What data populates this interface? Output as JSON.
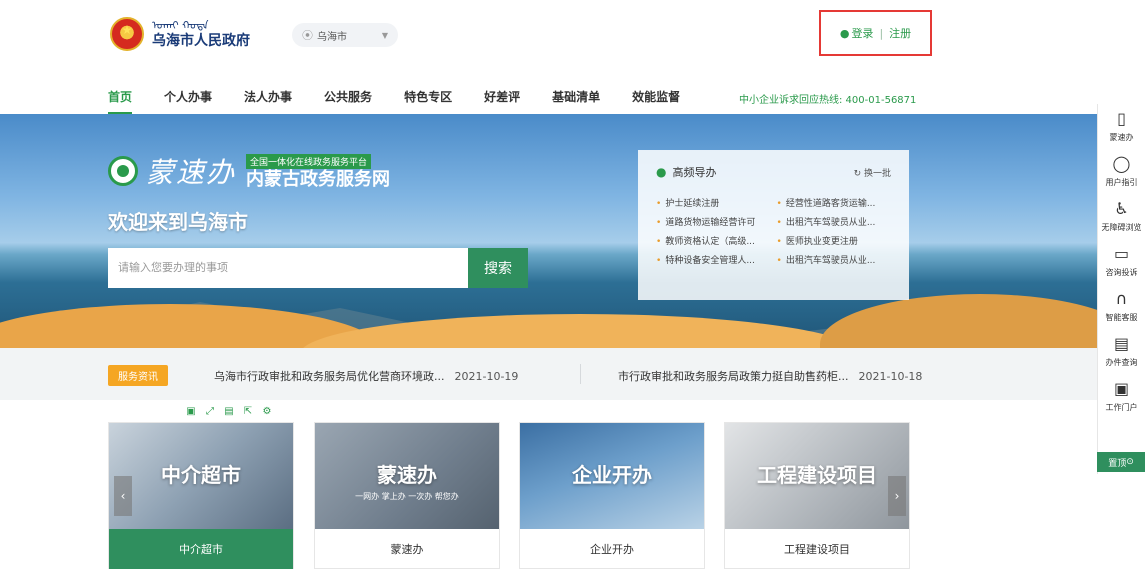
{
  "header": {
    "mongol_script": "ᠤᠬᠠᠢ ᠬᠣᠲᠠ",
    "city_name": "乌海市人民政府",
    "region_select": "乌海市",
    "login_label": "登录",
    "register_label": "注册",
    "separator": "|"
  },
  "nav": {
    "items": [
      "首页",
      "个人办事",
      "法人办事",
      "公共服务",
      "特色专区",
      "好差评",
      "基础清单",
      "效能监督"
    ],
    "hotline": "中小企业诉求回应热线: 400-01-56871"
  },
  "banner": {
    "brand_script": "蒙速办",
    "brand_tag": "全国一体化在线政务服务平台",
    "brand_title": "内蒙古政务服务网",
    "welcome": "欢迎来到乌海市",
    "search_placeholder": "请输入您要办理的事项",
    "search_button": "搜索"
  },
  "hot_panel": {
    "title": "高频导办",
    "refresh": "换一批",
    "items": [
      "护士延续注册",
      "经营性道路客货运输...",
      "道路货物运输经营许可",
      "出租汽车驾驶员从业...",
      "教师资格认定（高级...",
      "医师执业变更注册",
      "特种设备安全管理人...",
      "出租汽车驾驶员从业..."
    ]
  },
  "news": {
    "badge": "服务资讯",
    "items": [
      {
        "title": "乌海市行政审批和政务服务局优化营商环境政...",
        "date": "2021-10-19"
      },
      {
        "title": "市行政审批和政务服务局政策力挺自助售药柜...",
        "date": "2021-10-18"
      }
    ]
  },
  "cards": [
    {
      "image_text": "中介超市",
      "image_sub": "",
      "label": "中介超市"
    },
    {
      "image_text": "蒙速办",
      "image_sub": "一网办 掌上办 一次办 帮您办",
      "label": "蒙速办"
    },
    {
      "image_text": "企业开办",
      "image_sub": "",
      "label": "企业开办"
    },
    {
      "image_text": "工程建设项目",
      "image_sub": "",
      "label": "工程建设项目"
    }
  ],
  "sidebar": {
    "items": [
      {
        "label": "蒙速办",
        "icon": "mobile-icon"
      },
      {
        "label": "用户指引",
        "icon": "lightbulb-icon"
      },
      {
        "label": "无障碍浏览",
        "icon": "accessibility-icon"
      },
      {
        "label": "咨询投诉",
        "icon": "chat-icon"
      },
      {
        "label": "智能客服",
        "icon": "headset-icon"
      },
      {
        "label": "办件查询",
        "icon": "document-search-icon"
      },
      {
        "label": "工作门户",
        "icon": "monitor-icon"
      }
    ],
    "top_button": "置顶"
  },
  "colors": {
    "brand_green": "#2a9a4b",
    "button_green": "#2f8f5e",
    "badge_orange": "#f5a623",
    "highlight_red": "#e53935"
  }
}
